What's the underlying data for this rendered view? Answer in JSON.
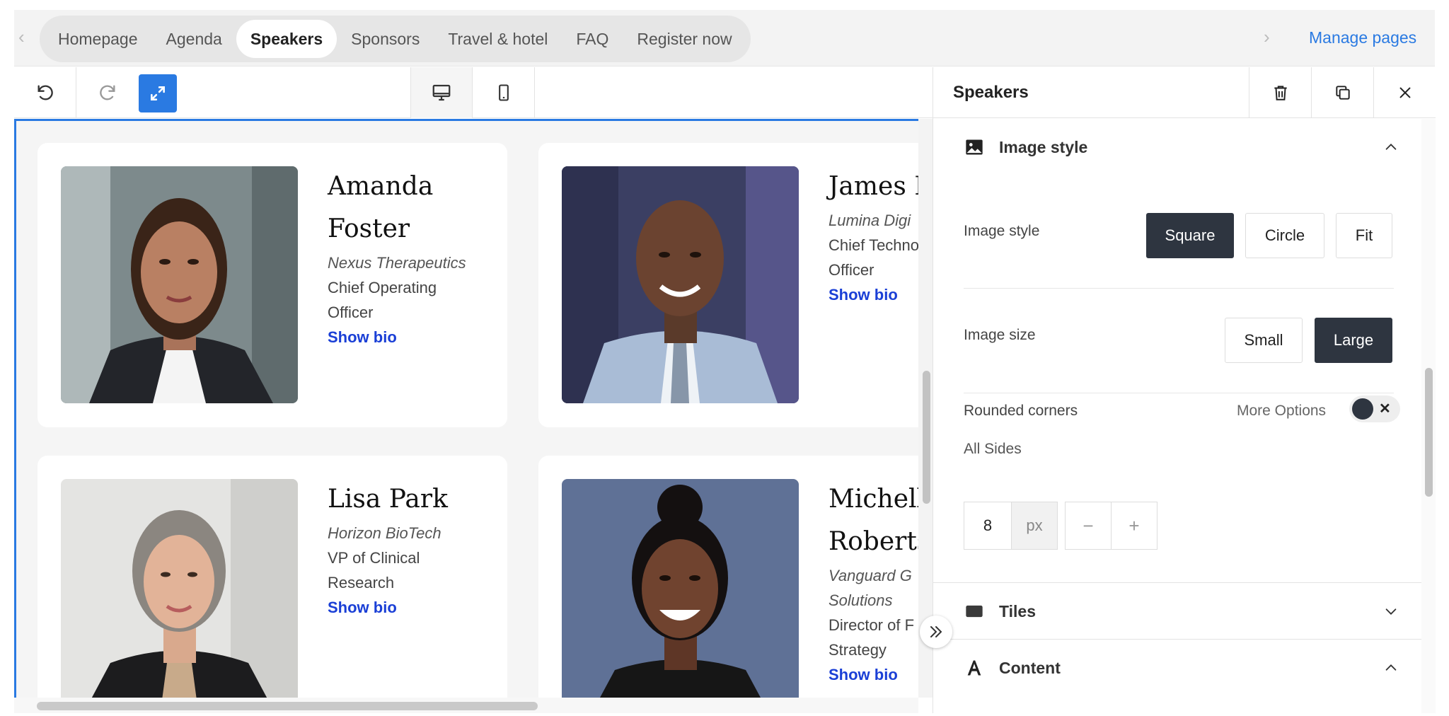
{
  "nav": {
    "tabs": [
      "Homepage",
      "Agenda",
      "Speakers",
      "Sponsors",
      "Travel & hotel",
      "FAQ",
      "Register now"
    ],
    "active_tab": "Speakers",
    "manage_pages": "Manage pages"
  },
  "speakers": [
    {
      "name_lines": [
        "Amanda",
        "Foster"
      ],
      "company": "Nexus Therapeutics",
      "role_lines": [
        "Chief Operating",
        "Officer"
      ],
      "bio": "Show bio"
    },
    {
      "name_lines": [
        "James L"
      ],
      "company": "Lumina Digi",
      "role_lines": [
        "Chief Techno",
        "Officer"
      ],
      "bio": "Show bio"
    },
    {
      "name_lines": [
        "Lisa Park"
      ],
      "company": "Horizon BioTech",
      "role_lines": [
        "VP of Clinical",
        "Research"
      ],
      "bio": "Show bio"
    },
    {
      "name_lines": [
        "Michelle",
        "Roberts"
      ],
      "company_lines": [
        "Vanguard G",
        "Solutions"
      ],
      "role_lines": [
        "Director of F",
        "Strategy"
      ],
      "bio": "Show bio"
    }
  ],
  "panel": {
    "title": "Speakers",
    "image_style_section": "Image style",
    "image_style_label": "Image style",
    "image_style_options": [
      "Square",
      "Circle",
      "Fit"
    ],
    "image_style_selected": "Square",
    "image_size_label": "Image size",
    "image_size_options": [
      "Small",
      "Large"
    ],
    "image_size_selected": "Large",
    "rounded_corners_label": "Rounded corners",
    "more_options": "More Options",
    "all_sides": "All Sides",
    "corner_value": "8",
    "corner_unit": "px",
    "tiles_section": "Tiles",
    "content_section": "Content"
  },
  "colors": {
    "accent": "#2a7ae2",
    "link": "#1a3fd6",
    "selected": "#2e3540"
  },
  "icons": [
    "chevron-left-icon",
    "chevron-right-icon",
    "undo-icon",
    "redo-icon",
    "expand-icon",
    "desktop-icon",
    "mobile-icon",
    "trash-icon",
    "duplicate-icon",
    "close-icon",
    "image-icon",
    "chevron-up-icon",
    "chevron-down-icon",
    "tiles-icon",
    "text-icon",
    "collapse-panel-icon"
  ]
}
